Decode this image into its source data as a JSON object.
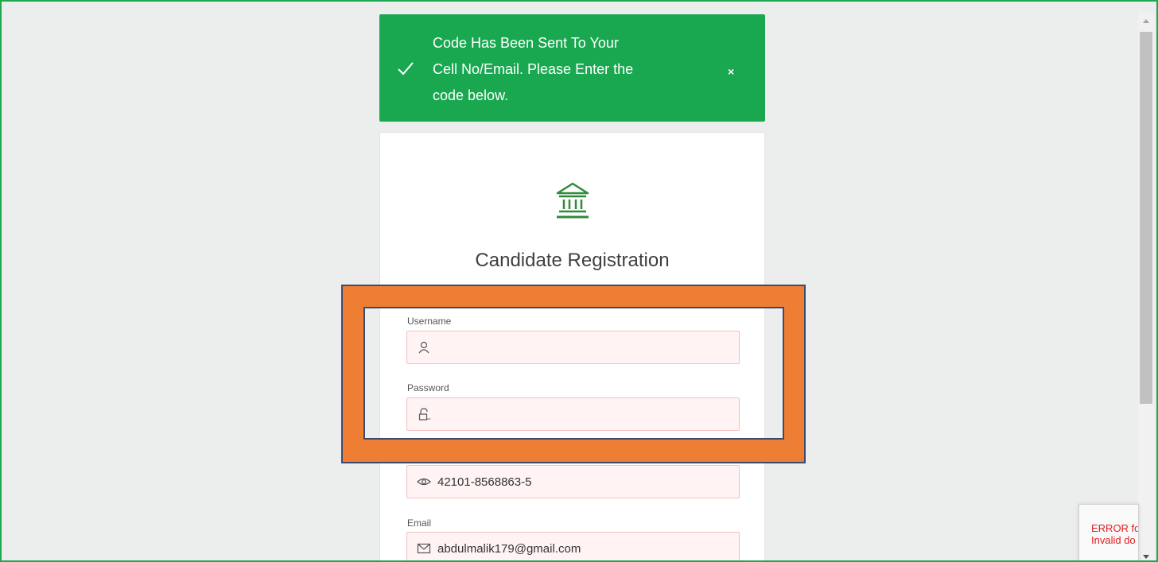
{
  "toast": {
    "lines": [
      "Code Has Been Sent To Your",
      "Cell No/Email. Please Enter the",
      "code below."
    ],
    "close_label": "×",
    "color": "#19a84f"
  },
  "card": {
    "icon": "bank-building-icon",
    "title": "Candidate Registration"
  },
  "fields": {
    "username": {
      "label": "Username",
      "value": "",
      "icon": "user-icon"
    },
    "password": {
      "label": "Password",
      "value": "",
      "icon": "lock-icon"
    },
    "cnic": {
      "value": "42101-8568863-5",
      "icon": "eye-icon"
    },
    "email": {
      "label": "Email",
      "value": "abdulmalik179@gmail.com",
      "icon": "mail-icon"
    }
  },
  "captcha": {
    "line1": "ERROR fo",
    "line2": "Invalid do"
  },
  "colors": {
    "accent_green": "#19a84f",
    "highlight_orange": "#ee7e33",
    "highlight_border": "#3c4a72",
    "input_error_bg": "#fff3f3",
    "error_text": "#e0201f"
  }
}
